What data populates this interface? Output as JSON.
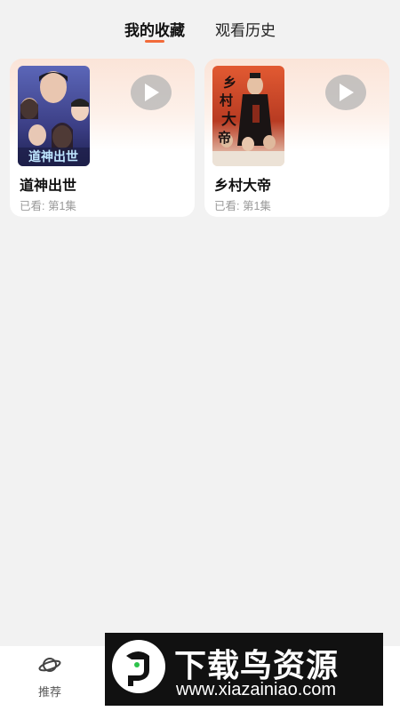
{
  "tabs": [
    {
      "label": "我的收藏",
      "active": true
    },
    {
      "label": "观看历史",
      "active": false
    }
  ],
  "cards": [
    {
      "title": "道神出世",
      "progress": "已看: 第1集",
      "poster_icon": "drama-poster"
    },
    {
      "title": "乡村大帝",
      "progress": "已看: 第1集",
      "poster_icon": "drama-poster"
    }
  ],
  "nav": {
    "items": [
      {
        "label": "推荐",
        "icon": "planet-icon"
      }
    ]
  },
  "watermark": {
    "title": "下载鸟资源",
    "url": "www.xiazainiao.com"
  },
  "colors": {
    "accent": "#f26b3a",
    "background": "#f2f2f2",
    "card_gradient_top": "#fbe4d8"
  }
}
